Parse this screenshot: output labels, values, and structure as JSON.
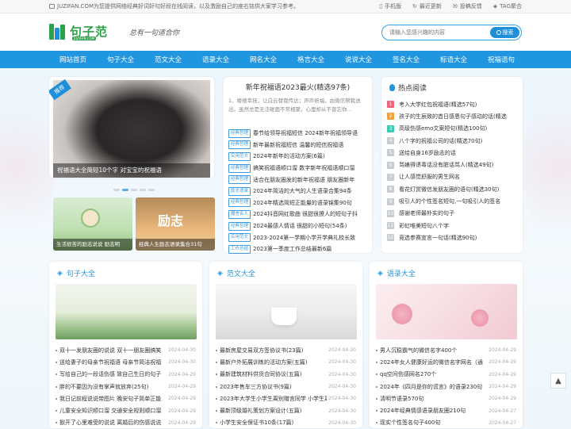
{
  "topbar": {
    "notice": "JUZIFAN.COM为您提供网络经典好词好句好段在线阅读，以及激励自己的座右铭供大家学习参考。",
    "links": [
      {
        "icon": "mobile-icon",
        "label": "手机版"
      },
      {
        "icon": "refresh-icon",
        "label": "最近更新"
      },
      {
        "icon": "feedback-icon",
        "label": "投稿反馈"
      },
      {
        "icon": "tag-icon",
        "label": "TAG聚合"
      }
    ]
  },
  "header": {
    "logo_text": "句子范",
    "logo_domain": "JUZIFAN.COM",
    "slogan": "总有一句适合你",
    "search_placeholder": "请输入您感兴趣的内容",
    "search_button": "搜索"
  },
  "nav": [
    "网站首页",
    "句子大全",
    "范文大全",
    "语录大全",
    "网名大全",
    "格言大全",
    "说说大全",
    "签名大全",
    "标语大全",
    "祝福语句"
  ],
  "colors": {
    "primary": "#2196e0",
    "logo_green": "#2fa04a"
  },
  "slider": {
    "tag": "推荐",
    "caption": "祝福语大全简短10个字 对宝宝的祝福语",
    "thumbs": [
      {
        "caption": "生活很苦的励志说说 励志明"
      },
      {
        "caption": "经典人生励志语录集合31句"
      }
    ],
    "thumb2_overlay_text": "励志"
  },
  "center": {
    "title": "新年祝福语2023最火(精选97条)",
    "desc": "1、楼楼幸挂，让白云替我传达；声声祝福，由微信帮我送出。虽然总是无法碰面不常相聚，心里却从不曾忘你…",
    "items": [
      {
        "label": "经典哲理",
        "text": "春节给领导祝福短信 2024新年祝福领导语"
      },
      {
        "label": "经典哲理",
        "text": "新年最新祝福短信 温馨的短信祝福语"
      },
      {
        "label": "实用范文",
        "text": "2024年新年的活动方案(6篇)"
      },
      {
        "label": "经典哲理",
        "text": "搞笑祝福语顺口溜 数字新年祝福语顺口溜"
      },
      {
        "label": "经典哲理",
        "text": "适合在朋友圈发的新年祝福语 朋友圈新年"
      },
      {
        "label": "励志语录",
        "text": "2024年简洁的大气的人生语录合集94条"
      },
      {
        "label": "经典哲理",
        "text": "2024年精选简短正能量的语录锦集90句"
      },
      {
        "label": "赠言名人",
        "text": "2024抖音网红歌曲 很甜很撩人的短句子抖"
      },
      {
        "label": "经典哲理",
        "text": "2024最感人情话 很甜的小短句(54条)"
      },
      {
        "label": "实用范文",
        "text": "2023-2024第一学期小学开学典礼校长致"
      },
      {
        "label": "工作总结",
        "text": "2023第一季度工作总结最新6篇"
      }
    ]
  },
  "hot": {
    "title": "热点阅读",
    "items": [
      {
        "num": "1",
        "text": "考入大学红包祝福语(精选57句)"
      },
      {
        "num": "2",
        "text": "孩子的生辰致的首日感恩句子感动的话(精选"
      },
      {
        "num": "3",
        "text": "高级伤感emo文案短句(精选100句)"
      },
      {
        "num": "4",
        "text": "八个字的祝福公司的话(精选70句)"
      },
      {
        "num": "5",
        "text": "送给自身16岁励志的话"
      },
      {
        "num": "6",
        "text": "骂婊得诱毒话没有脏话骂人(精选49句)"
      },
      {
        "num": "7",
        "text": "让人感觉舒服的男生网名"
      },
      {
        "num": "8",
        "text": "看花灯赏微信发朋友圈的语句(精选30句)"
      },
      {
        "num": "9",
        "text": "吸引人的个性签名短句,一句吸引人的签名"
      },
      {
        "num": "10",
        "text": "感谢老师最朴实的句子"
      },
      {
        "num": "11",
        "text": "彩虹唯美短句八个字"
      },
      {
        "num": "12",
        "text": "竞选参赛宣言一句话(精选90句)"
      }
    ]
  },
  "cards": [
    {
      "title": "句子大全",
      "items": [
        {
          "text": "双十一发朋友圈的说说 双十一朋友圈搞笑",
          "date": "2024-04-30"
        },
        {
          "text": "送给妻子的母亲节祝福语 母亲节简洁祝福",
          "date": "2024-04-30"
        },
        {
          "text": "写给自己的一段话伤感 致自己生日的句子",
          "date": "2024-04-29"
        },
        {
          "text": "胖的不要因为没有掌声就放弃(25句)",
          "date": "2024-04-29"
        },
        {
          "text": "我日记前程说说带图片 晚安句子简单正能",
          "date": "2024-04-29"
        },
        {
          "text": "儿童安全知识顺口溜 交通安全规则顺口溜",
          "date": "2024-04-29"
        },
        {
          "text": "掀开了心里难受的说说 离婚后的伤感说说",
          "date": "2024-04-29"
        }
      ]
    },
    {
      "title": "范文大全",
      "items": [
        {
          "text": "最新房屋交易双方签协议书(23篇)",
          "date": "2024-04-30"
        },
        {
          "text": "最新户外拓展训练的活动方案(五篇)",
          "date": "2024-04-30"
        },
        {
          "text": "最新建筑材料供货合同协议(五篇)",
          "date": "2024-04-30"
        },
        {
          "text": "2023年售车三方协议书(9篇)",
          "date": "2024-04-30"
        },
        {
          "text": "2023年大学生小学生离别赠言同学 小学生离别",
          "date": "2024-04-30"
        },
        {
          "text": "最新顶级婚礼策划方案设计(五篇)",
          "date": "2024-04-30"
        },
        {
          "text": "小学生安全保证书10条(17篇)",
          "date": "2024-04-30"
        }
      ]
    },
    {
      "title": "语录大全",
      "items": [
        {
          "text": "男人沉稳霸气的微信名字400个",
          "date": "2024-04-29"
        },
        {
          "text": "2024年女人健康好运的微信名字网名（通",
          "date": "2024-04-29"
        },
        {
          "text": "qq空间伤感网名270个",
          "date": "2024-04-29"
        },
        {
          "text": "2024年《四月是你的谎言》的语录230句",
          "date": "2024-04-29"
        },
        {
          "text": "清明节语录570句",
          "date": "2024-04-29"
        },
        {
          "text": "2024年经典情感语录朋友圈210句",
          "date": "2024-04-27"
        },
        {
          "text": "现实个性签名句子400句",
          "date": "2024-04-27"
        }
      ]
    }
  ]
}
